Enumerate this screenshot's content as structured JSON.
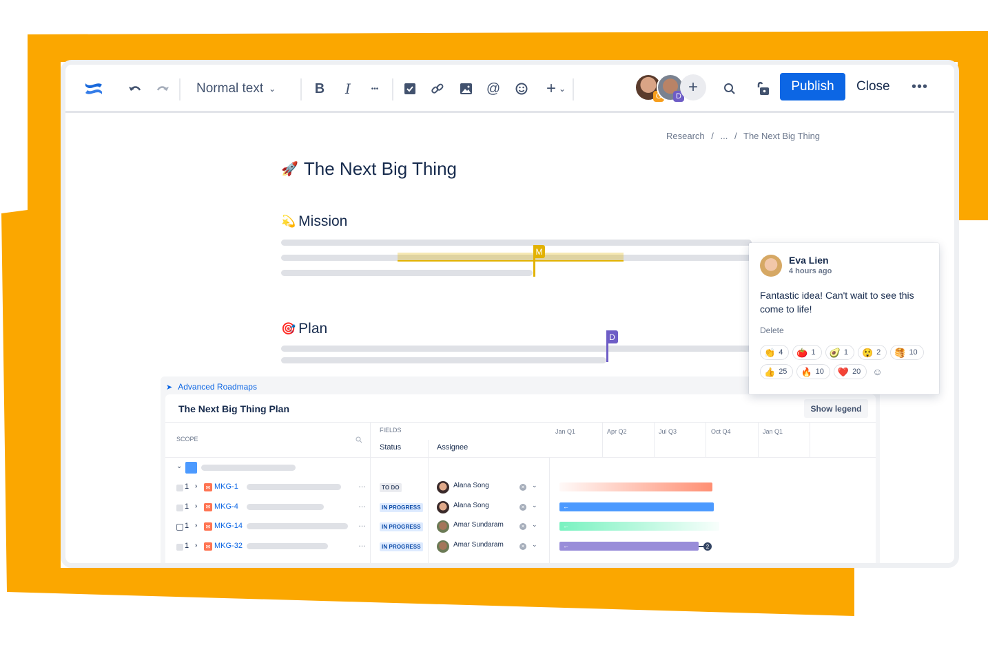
{
  "colors": {
    "backdrop": "#FBA700",
    "primary": "#0C66E4",
    "cursor_m": "#E2B203",
    "cursor_d": "#6E5DC6",
    "badge_g": "#F79E1B",
    "badge_d": "#6E5DC6"
  },
  "toolbar": {
    "logo": "confluence-logo",
    "undo_icon": "undo-icon",
    "redo_icon": "redo-icon",
    "text_style": "Normal text",
    "bold": "B",
    "italic": "I",
    "more_formatting": "•••",
    "icons": [
      "task-checkbox-icon",
      "link-icon",
      "image-icon",
      "mention-icon",
      "emoji-icon",
      "insert-plus-icon"
    ],
    "collaborators": [
      {
        "initial": "G"
      },
      {
        "initial": "D"
      }
    ],
    "add_collaborator": "+",
    "publish_label": "Publish",
    "close_label": "Close",
    "more_label": "•••"
  },
  "breadcrumb": [
    "Research",
    "/",
    "...",
    "/",
    "The Next Big Thing"
  ],
  "page": {
    "title_emoji": "🚀",
    "title": "The Next Big Thing",
    "sections": [
      {
        "emoji": "💫",
        "heading": "Mission"
      },
      {
        "emoji": "🎯",
        "heading": "Plan"
      }
    ],
    "cursors": [
      {
        "initial": "M"
      },
      {
        "initial": "D"
      }
    ]
  },
  "comment": {
    "author": "Eva Lien",
    "time": "4 hours ago",
    "body": "Fantastic idea! Can't wait to see this come to life!",
    "delete_label": "Delete",
    "reactions": [
      {
        "emoji": "👏",
        "count": "4"
      },
      {
        "emoji": "🍅",
        "count": "1"
      },
      {
        "emoji": "🥑",
        "count": "1"
      },
      {
        "emoji": "😲",
        "count": "2"
      },
      {
        "emoji": "🥞",
        "count": "10"
      },
      {
        "emoji": "👍",
        "count": "25"
      },
      {
        "emoji": "🔥",
        "count": "10"
      },
      {
        "emoji": "❤️",
        "count": "20"
      }
    ],
    "add_reaction_icon": "☺"
  },
  "roadmap": {
    "macro_label": "Advanced Roadmaps",
    "title": "The Next Big Thing Plan",
    "legend_button": "Show legend",
    "scope_header": "SCOPE",
    "fields_header": "FIELDS",
    "status_col": "Status",
    "assignee_col": "Assignee",
    "timeline": [
      "Jan Q1",
      "Apr Q2",
      "Jul Q3",
      "Oct Q4",
      "Jan Q1"
    ],
    "rows": [
      {
        "count": "1",
        "key": "MKG-1",
        "status": "TO DO",
        "status_type": "todo",
        "assignee": "Alana Song",
        "bar_color": "#FF8F73",
        "bar_style": "fade-in"
      },
      {
        "count": "1",
        "key": "MKG-4",
        "status": "IN PROGRESS",
        "status_type": "prog",
        "assignee": "Alana Song",
        "bar_color": "#4C9AFF",
        "bar_style": "solid"
      },
      {
        "count": "1",
        "key": "MKG-14",
        "status": "IN PROGRESS",
        "status_type": "prog",
        "assignee": "Amar Sundaram",
        "bar_color": "#79F2C0",
        "bar_style": "fade-out"
      },
      {
        "count": "1",
        "key": "MKG-32",
        "status": "IN PROGRESS",
        "status_type": "prog",
        "assignee": "Amar Sundaram",
        "bar_color": "#998DD9",
        "bar_style": "solid",
        "dependencies": "2"
      }
    ],
    "bar_arrow": "←"
  }
}
